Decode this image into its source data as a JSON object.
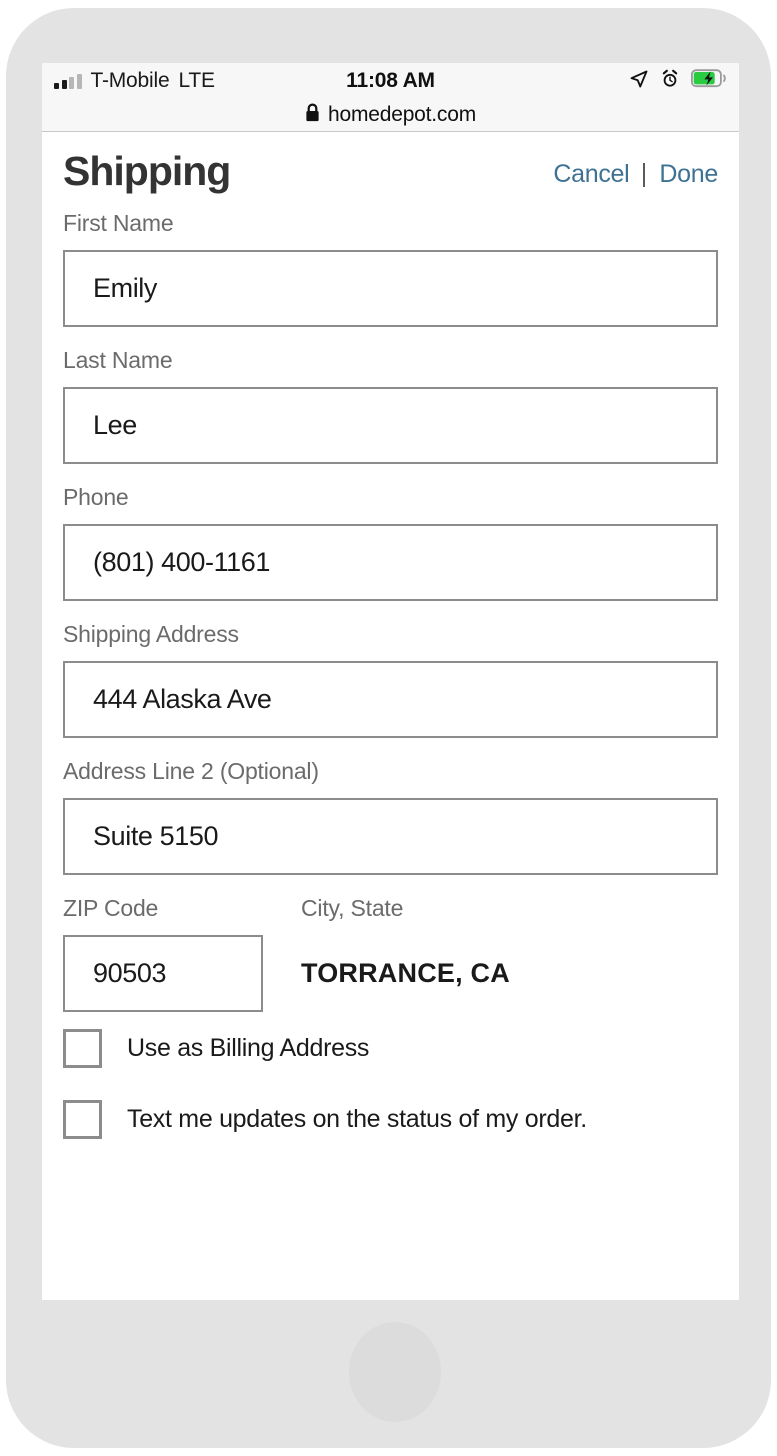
{
  "status_bar": {
    "carrier": "T-Mobile",
    "network": "LTE",
    "time": "11:08 AM",
    "signal_icon": "signal-bars-icon",
    "location_icon": "location-arrow-icon",
    "alarm_icon": "alarm-clock-icon",
    "battery_icon": "battery-charging-icon",
    "battery_charging": true
  },
  "browser": {
    "lock_icon": "lock-icon",
    "url": "homedepot.com"
  },
  "header": {
    "title": "Shipping",
    "cancel_label": "Cancel",
    "done_label": "Done",
    "link_color": "#3d7294"
  },
  "form": {
    "fields": [
      {
        "label": "First Name",
        "value": "Emily"
      },
      {
        "label": "Last Name",
        "value": "Lee"
      },
      {
        "label": "Phone",
        "value": "(801) 400-1161"
      },
      {
        "label": "Shipping Address",
        "value": "444 Alaska Ave"
      },
      {
        "label": "Address Line 2 (Optional)",
        "value": "Suite 5150"
      }
    ],
    "zip": {
      "label": "ZIP Code",
      "value": "90503"
    },
    "city_state": {
      "label": "City, State",
      "value": "TORRANCE, CA"
    },
    "checkboxes": [
      {
        "label": "Use as Billing Address",
        "checked": false
      },
      {
        "label": "Text me updates on the status of my order.",
        "checked": false
      }
    ]
  }
}
